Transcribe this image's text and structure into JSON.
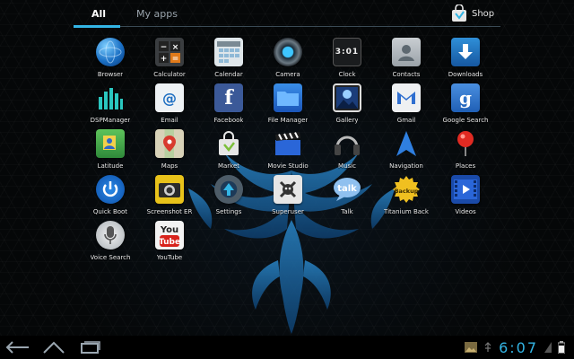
{
  "tabs": {
    "all": "All",
    "my_apps": "My apps",
    "shop": "Shop"
  },
  "apps": [
    {
      "label": "Browser",
      "icon": "globe-icon"
    },
    {
      "label": "Calculator",
      "icon": "calculator-icon"
    },
    {
      "label": "Calendar",
      "icon": "calendar-icon"
    },
    {
      "label": "Camera",
      "icon": "camera-icon"
    },
    {
      "label": "Clock",
      "icon": "clock-icon"
    },
    {
      "label": "Contacts",
      "icon": "contacts-icon"
    },
    {
      "label": "Downloads",
      "icon": "download-icon"
    },
    {
      "label": "DSPManager",
      "icon": "equalizer-icon"
    },
    {
      "label": "Email",
      "icon": "email-icon"
    },
    {
      "label": "Facebook",
      "icon": "facebook-icon"
    },
    {
      "label": "File Manager",
      "icon": "folder-icon"
    },
    {
      "label": "Gallery",
      "icon": "gallery-icon"
    },
    {
      "label": "Gmail",
      "icon": "gmail-icon"
    },
    {
      "label": "Google Search",
      "icon": "google-search-icon"
    },
    {
      "label": "Latitude",
      "icon": "latitude-icon"
    },
    {
      "label": "Maps",
      "icon": "maps-icon"
    },
    {
      "label": "Market",
      "icon": "market-icon"
    },
    {
      "label": "Movie Studio",
      "icon": "clapperboard-icon"
    },
    {
      "label": "Music",
      "icon": "headphones-icon"
    },
    {
      "label": "Navigation",
      "icon": "navigation-arrow-icon"
    },
    {
      "label": "Places",
      "icon": "map-pin-icon"
    },
    {
      "label": "Quick Boot",
      "icon": "power-icon"
    },
    {
      "label": "Screenshot ER",
      "icon": "screenshot-camera-icon"
    },
    {
      "label": "Settings",
      "icon": "settings-icon"
    },
    {
      "label": "Superuser",
      "icon": "superuser-icon"
    },
    {
      "label": "Talk",
      "icon": "talk-bubble-icon"
    },
    {
      "label": "Titanium Back",
      "icon": "titanium-backup-icon"
    },
    {
      "label": "Videos",
      "icon": "video-icon"
    },
    {
      "label": "Voice Search",
      "icon": "microphone-icon"
    },
    {
      "label": "YouTube",
      "icon": "youtube-icon"
    }
  ],
  "status": {
    "time": "6:07"
  },
  "colors": {
    "accent": "#33b5e5",
    "background": "#050708"
  }
}
